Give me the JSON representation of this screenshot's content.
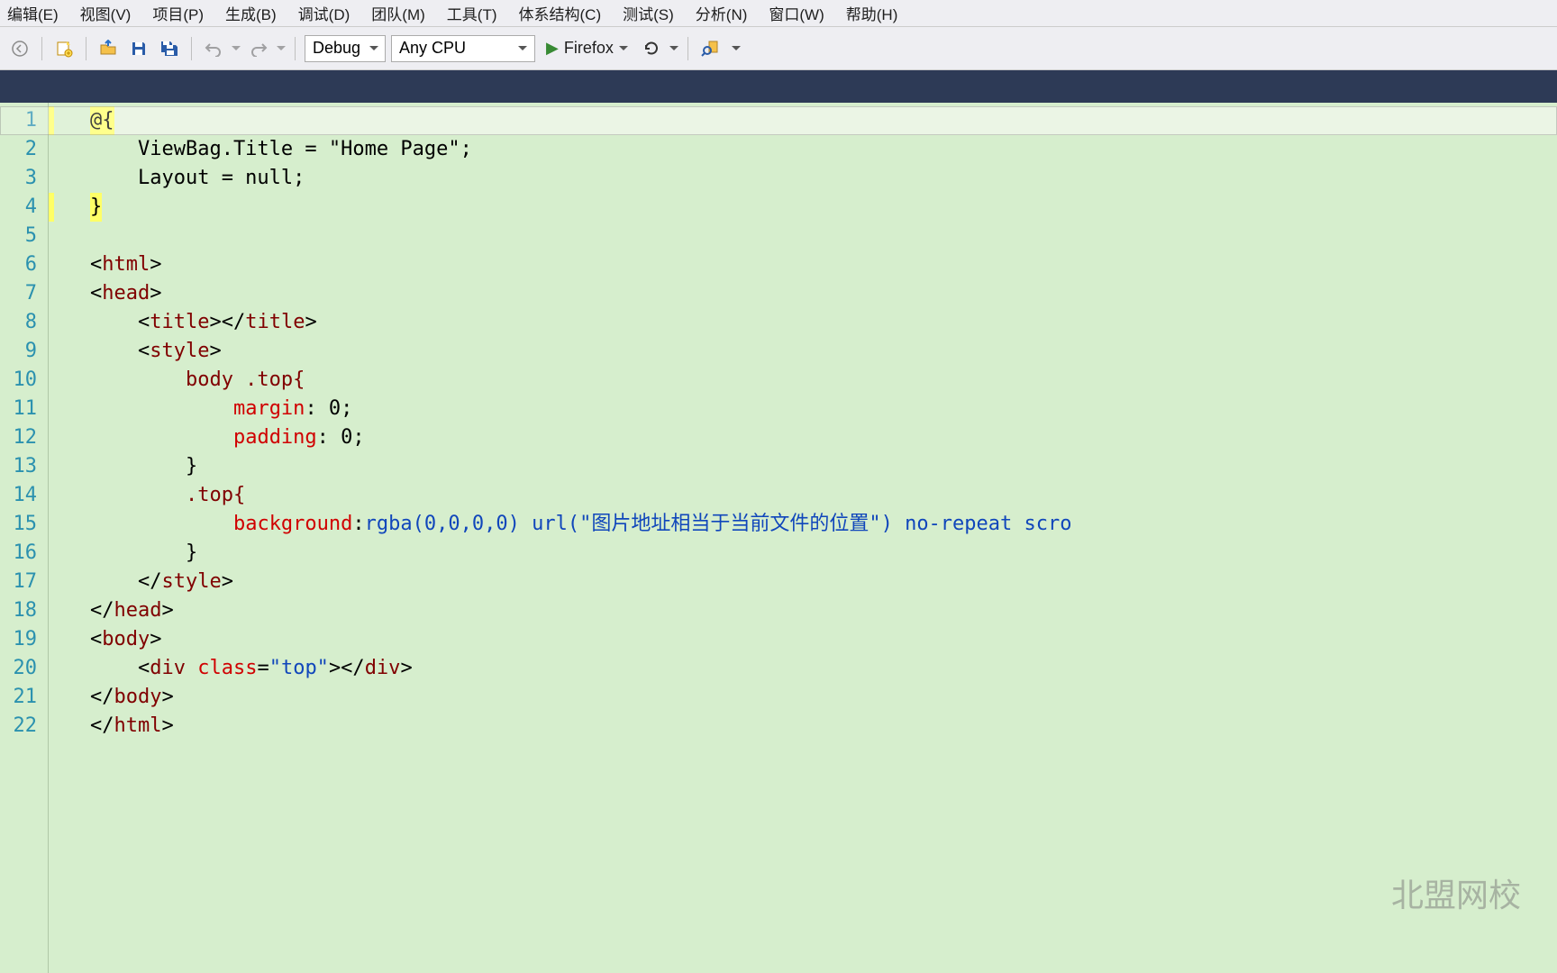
{
  "menu": {
    "items": [
      "编辑(E)",
      "视图(V)",
      "项目(P)",
      "生成(B)",
      "调试(D)",
      "团队(M)",
      "工具(T)",
      "体系结构(C)",
      "测试(S)",
      "分析(N)",
      "窗口(W)",
      "帮助(H)"
    ]
  },
  "toolbar": {
    "config": "Debug",
    "platform": "Any CPU",
    "browser": "Firefox"
  },
  "line_numbers": [
    "1",
    "2",
    "3",
    "4",
    "5",
    "6",
    "7",
    "8",
    "9",
    "10",
    "11",
    "12",
    "13",
    "14",
    "15",
    "16",
    "17",
    "18",
    "19",
    "20",
    "21",
    "22"
  ],
  "code": {
    "l1": "@{",
    "l2": "    ViewBag.Title = \"Home Page\";",
    "l3": "    Layout = null;",
    "l4": "}",
    "l5": "",
    "l6_open": "<",
    "l6_tag": "html",
    "l6_close": ">",
    "l7_open": "<",
    "l7_tag": "head",
    "l7_close": ">",
    "l8_open": "    <",
    "l8_tag1": "title",
    "l8_mid": "></",
    "l8_tag2": "title",
    "l8_close": ">",
    "l9_open": "    <",
    "l9_tag": "style",
    "l9_close": ">",
    "l10": "        body .top{",
    "l11_pre": "            ",
    "l11_prop": "margin",
    "l11_rest": ": 0;",
    "l12_pre": "            ",
    "l12_prop": "padding",
    "l12_rest": ": 0;",
    "l13": "        }",
    "l14": "        .top{",
    "l15_pre": "            ",
    "l15_prop": "background",
    "l15_colon": ":",
    "l15_v1": "rgba(0,0,0,0) url(",
    "l15_str": "\"图片地址相当于当前文件的位置\"",
    "l15_v2": ") no-repeat scro",
    "l16": "        }",
    "l17_open": "    </",
    "l17_tag": "style",
    "l17_close": ">",
    "l18_open": "</",
    "l18_tag": "head",
    "l18_close": ">",
    "l19_open": "<",
    "l19_tag": "body",
    "l19_close": ">",
    "l20_open": "    <",
    "l20_tag1": "div ",
    "l20_attr": "class",
    "l20_eq": "=",
    "l20_str": "\"top\"",
    "l20_mid": "></",
    "l20_tag2": "div",
    "l20_close": ">",
    "l21_open": "</",
    "l21_tag": "body",
    "l21_close": ">",
    "l22_open": "</",
    "l22_tag": "html",
    "l22_close": ">"
  },
  "watermark": "北盟网校"
}
